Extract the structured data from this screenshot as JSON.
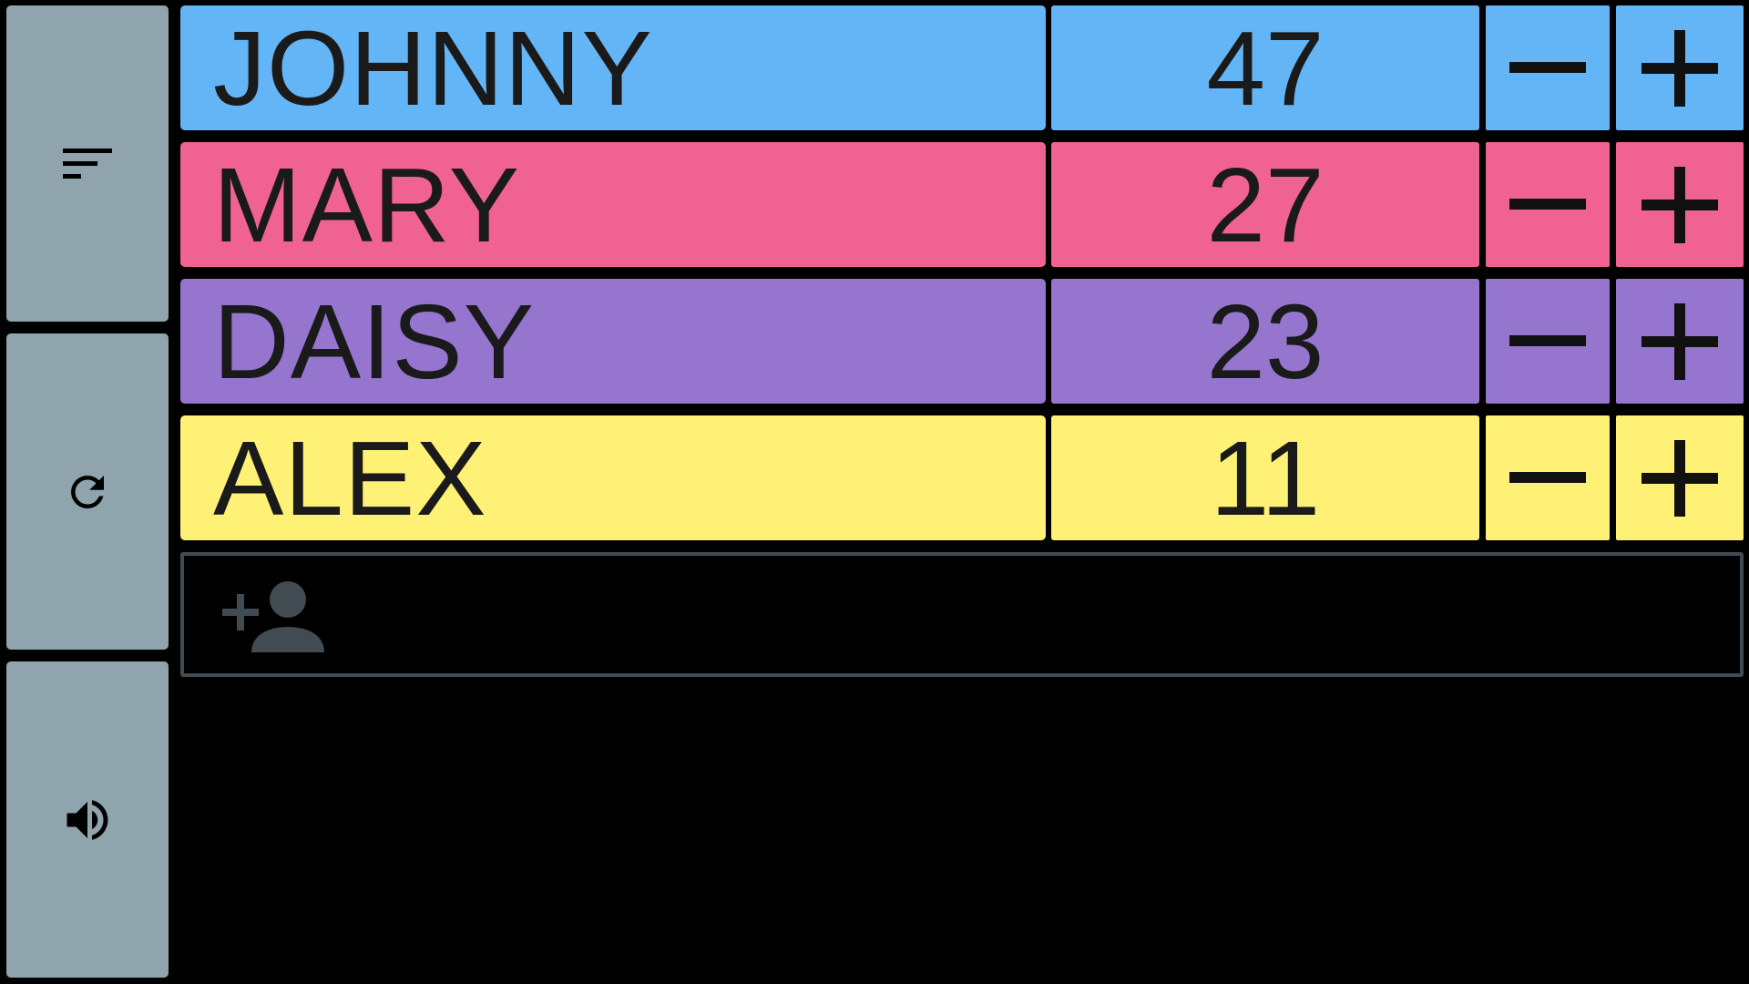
{
  "sidebar": {
    "sort_icon": "sort-icon",
    "reset_icon": "refresh-icon",
    "sound_icon": "volume-icon",
    "color": "#90a4ae"
  },
  "players": [
    {
      "name": "JOHNNY",
      "score": "47",
      "color": "#64b5f6"
    },
    {
      "name": "MARY",
      "score": "27",
      "color": "#f06292"
    },
    {
      "name": "DAISY",
      "score": "23",
      "color": "#9575cd"
    },
    {
      "name": "ALEX",
      "score": "11",
      "color": "#fff176"
    }
  ],
  "controls": {
    "minus_icon": "minus-icon",
    "plus_icon": "plus-icon"
  },
  "add_player": {
    "icon": "add-person-icon",
    "border_color": "#414b52"
  }
}
